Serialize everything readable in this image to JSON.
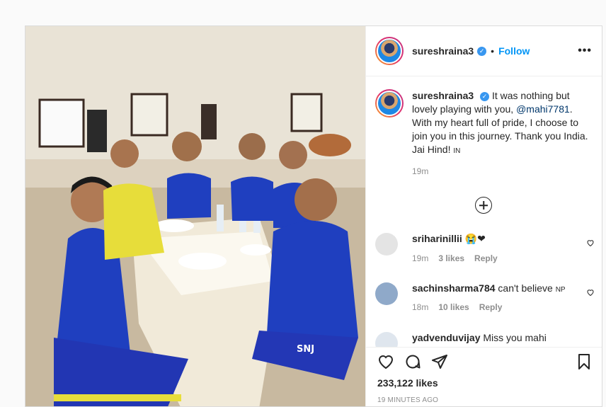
{
  "post": {
    "username": "sureshraina3",
    "follow_label": "Follow",
    "more_label": "•••",
    "caption_user": "sureshraina3",
    "caption_text_1": "It was nothing but lovely playing with you,",
    "caption_mention": "@mahi7781",
    "caption_text_2": ". With my heart full of pride, I choose to join you in this journey. Thank you India. Jai Hind!",
    "caption_flag": "IN",
    "caption_time": "19m",
    "likes": "233,122 likes",
    "posted_ago": "19 MINUTES AGO"
  },
  "comments": [
    {
      "user": "sriharinillii",
      "text": "😭❤",
      "time": "19m",
      "likes": "3 likes",
      "reply": "Reply",
      "avatar_color": "#e8e8e8"
    },
    {
      "user": "sachinsharma784",
      "text": "can't believe",
      "flag": "NP",
      "time": "18m",
      "likes": "10 likes",
      "reply": "Reply",
      "avatar_color": "#8fa9c9"
    },
    {
      "user": "yadvenduvijay",
      "text": "Miss you mahi",
      "avatar_color": "#dfe6ee"
    }
  ],
  "photo": {
    "jersey_text": "SNJ"
  },
  "colors": {
    "accent": "#0095f6",
    "verified": "#3897f0",
    "jersey": "#1f3fbf"
  }
}
